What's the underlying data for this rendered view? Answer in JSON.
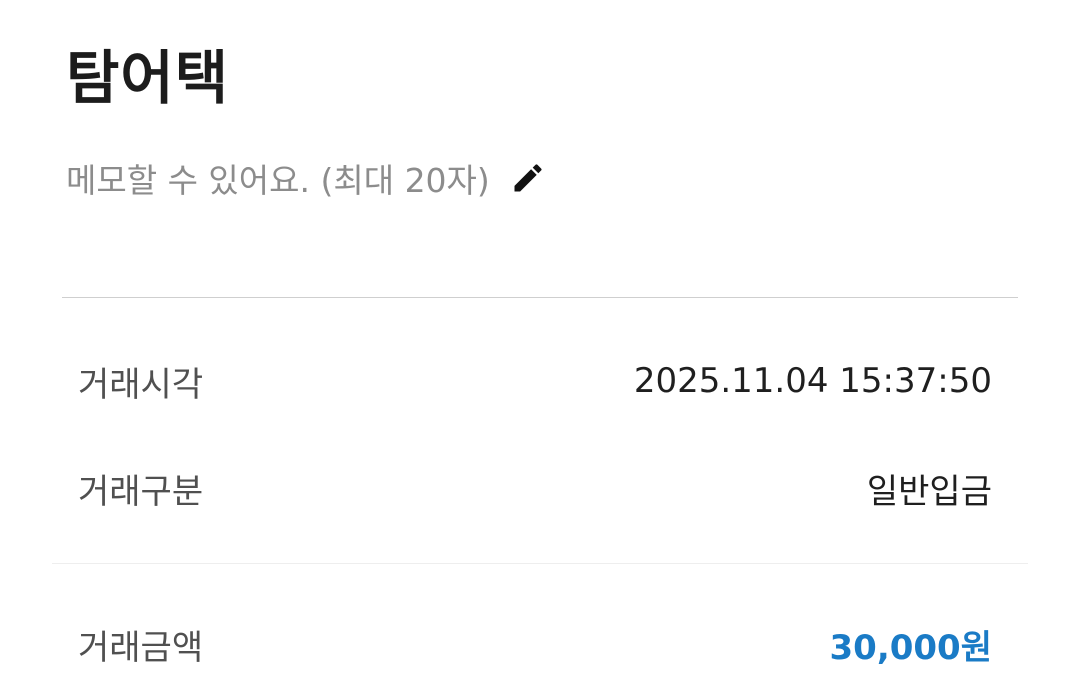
{
  "header": {
    "title": "탐어택",
    "memo_placeholder": "메모할 수 있어요. (최대 20자)",
    "edit_icon": "pencil-icon"
  },
  "details": {
    "time": {
      "label": "거래시각",
      "value": "2025.11.04 15:37:50"
    },
    "type": {
      "label": "거래구분",
      "value": "일반입금"
    },
    "amount": {
      "label": "거래금액",
      "value": "30,000원"
    }
  },
  "colors": {
    "amount": "#1a7bc6",
    "memo_text": "#8c8c8c",
    "divider": "#cfcfcf"
  }
}
